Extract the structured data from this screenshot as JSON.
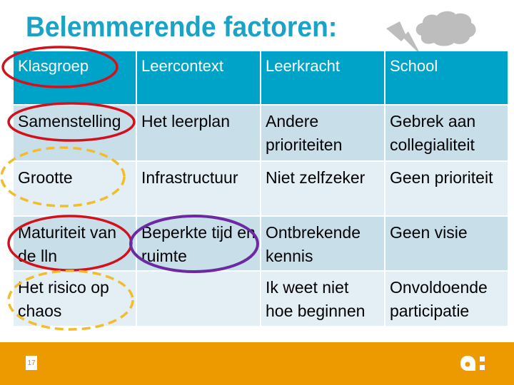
{
  "slide": {
    "title": "Belemmerende factoren:",
    "page_number": "17",
    "colors": {
      "title": "#1aa3c6",
      "header_bg": "#00a3c8",
      "row_dark": "#c8dfea",
      "row_light": "#e3eef5",
      "footer": "#ec9a00",
      "highlight_red": "#d3111c",
      "highlight_yellow": "#f2bd2c",
      "highlight_purple": "#6c2aa0"
    }
  },
  "table": {
    "headers": [
      "Klasgroep",
      "Leercontext",
      "Leerkracht",
      "School"
    ],
    "rows": [
      [
        "Samenstelling",
        "Het leerplan",
        "Andere prioriteiten",
        "Gebrek aan collegialiteit"
      ],
      [
        "Grootte",
        "Infrastructuur",
        "Niet zelfzeker",
        "Geen prioriteit"
      ],
      [
        "Maturiteit van de lln",
        "Beperkte tijd en ruimte",
        "Ontbrekende kennis",
        "Geen visie"
      ],
      [
        "Het risico op chaos",
        "",
        "Ik weet niet hoe beginnen",
        "Onvoldoende participatie"
      ]
    ]
  },
  "annotations": [
    {
      "type": "red-ellipse",
      "target": "Klasgroep"
    },
    {
      "type": "red-ellipse",
      "target": "Samenstelling"
    },
    {
      "type": "yellow-dashed-ellipse",
      "target": "Grootte"
    },
    {
      "type": "red-ellipse",
      "target": "Maturiteit van de lln"
    },
    {
      "type": "purple-ellipse",
      "target": "Beperkte tijd en ruimte"
    },
    {
      "type": "yellow-dashed-ellipse",
      "target": "Het risico op chaos"
    }
  ],
  "icons": {
    "weather": "storm-cloud-lightning-icon",
    "logo": "brand-logo-icon"
  }
}
